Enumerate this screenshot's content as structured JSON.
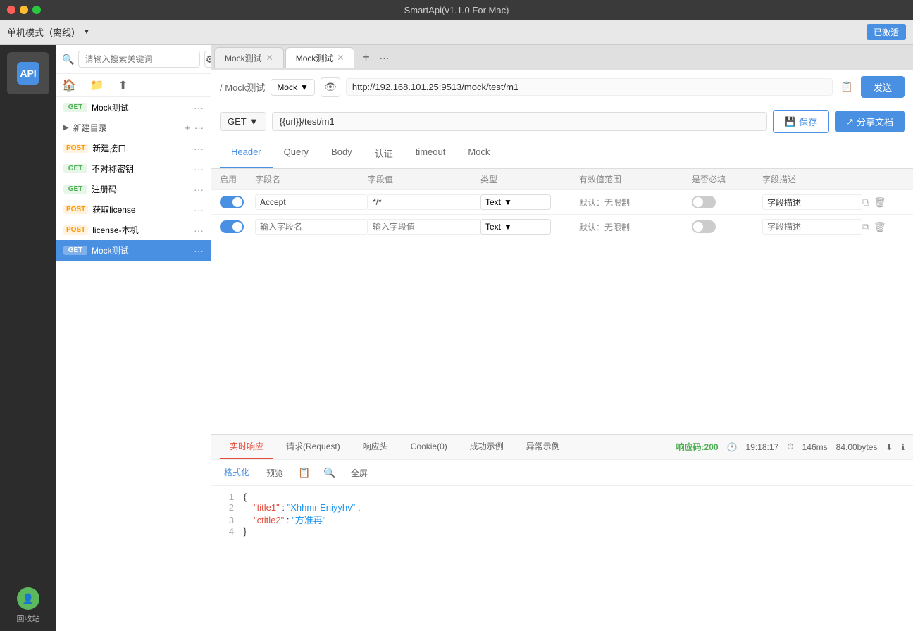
{
  "titlebar": {
    "title": "SmartApi(v1.1.0 For Mac)"
  },
  "top_toolbar": {
    "mode": "单机模式（离线）",
    "activated": "已激活"
  },
  "sidebar": {
    "api_label": "API",
    "recycle_label": "回收站"
  },
  "file_panel": {
    "search_placeholder": "请输入搜索关键词",
    "api_items": [
      {
        "method": "GET",
        "name": "Mock测试",
        "active": false
      },
      {
        "folder": true,
        "name": "新建目录"
      },
      {
        "method": "POST",
        "name": "新建接口",
        "active": false
      },
      {
        "method": "GET",
        "name": "不对称密钥",
        "active": false
      },
      {
        "method": "GET",
        "name": "注册码",
        "active": false
      },
      {
        "method": "POST",
        "name": "获取license",
        "active": false
      },
      {
        "method": "POST",
        "name": "license-本机",
        "active": false
      },
      {
        "method": "GET",
        "name": "Mock测试",
        "active": true
      }
    ]
  },
  "tabs": [
    {
      "label": "Mock测试",
      "active": false
    },
    {
      "label": "Mock测试",
      "active": true
    }
  ],
  "url_bar": {
    "breadcrumb_sep": "/",
    "breadcrumb_page": "Mock测试",
    "mock_label": "Mock",
    "url": "http://192.168.101.25:9513/mock/test/m1",
    "send_label": "发送"
  },
  "method_bar": {
    "method": "GET",
    "path": "{{url}}/test/m1",
    "save_label": "保存",
    "share_label": "分享文档"
  },
  "tab_nav": {
    "tabs": [
      "Header",
      "Query",
      "Body",
      "认证",
      "timeout",
      "Mock"
    ]
  },
  "param_table": {
    "headers": [
      "启用",
      "字段名",
      "字段值",
      "类型",
      "有效值范围",
      "是否必填",
      "字段描述",
      ""
    ],
    "rows": [
      {
        "enabled": true,
        "field_name": "Accept",
        "field_value": "*/*",
        "type": "Text",
        "range": "默认：无限制",
        "required": false,
        "description": "字段描述"
      },
      {
        "enabled": true,
        "field_name": "输入字段名",
        "field_value": "输入字段值",
        "type": "Text",
        "range": "默认：无限制",
        "required": false,
        "description": "字段描述"
      }
    ]
  },
  "response_panel": {
    "tabs": [
      "实时响应",
      "请求(Request)",
      "响应头",
      "Cookie(0)",
      "成功示例",
      "异常示例"
    ],
    "active_tab": "实时响应",
    "status_code": "响应码:200",
    "time": "19:18:17",
    "duration": "146ms",
    "size": "84.00bytes",
    "toolbar": {
      "format_label": "格式化",
      "preview_label": "预览",
      "fullscreen_label": "全屏"
    },
    "json_lines": [
      {
        "num": 1,
        "content": "{"
      },
      {
        "num": 2,
        "content": "    \"title1\" :  \"Xhhmr Eniyyhv\" ,"
      },
      {
        "num": 3,
        "content": "    \"ctitle2\" :  \"方准再\""
      },
      {
        "num": 4,
        "content": "}"
      }
    ]
  }
}
